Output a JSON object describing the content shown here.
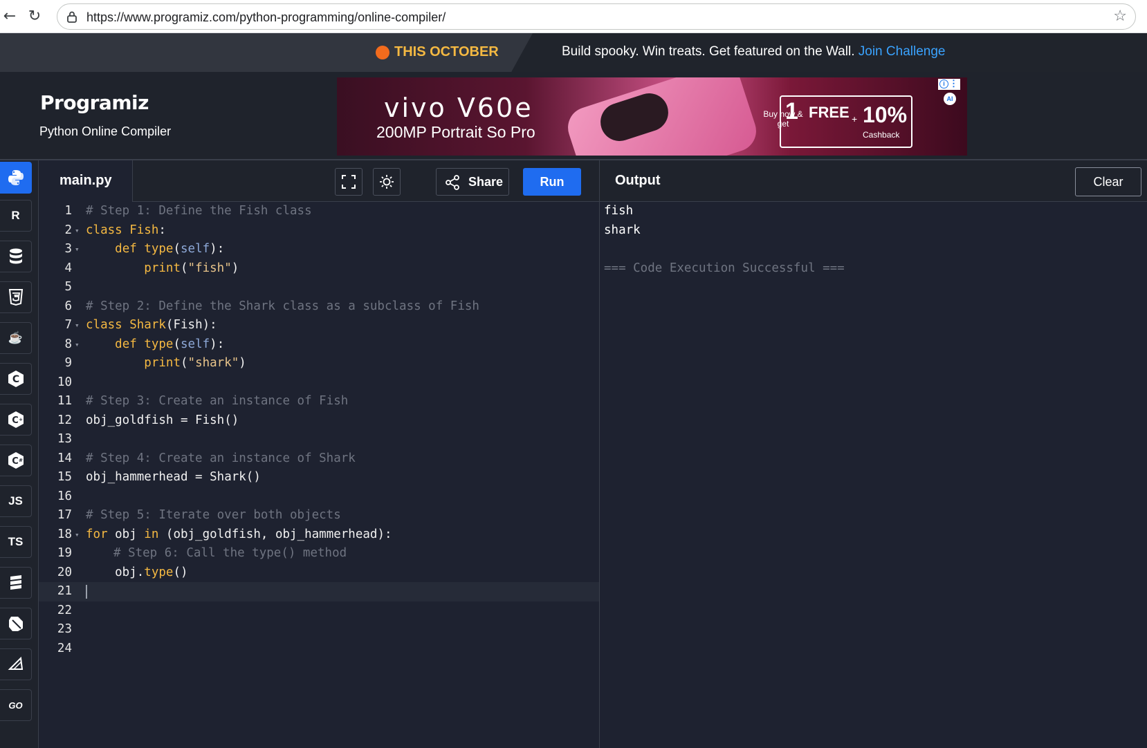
{
  "browser": {
    "url": "https://www.programiz.com/python-programming/online-compiler/"
  },
  "promo": {
    "tag": "THIS OCTOBER",
    "message": "Build spooky. Win treats. Get featured on the Wall.",
    "link": "Join Challenge"
  },
  "header": {
    "logo": "Programiz",
    "subtitle": "Python Online Compiler"
  },
  "ad": {
    "brand": "vivo V60e",
    "tagline": "200MP Portrait So Pro",
    "buy_now": "Buy now & get",
    "free_num": "1",
    "free": "FREE",
    "percent": "10%",
    "cashback": "Cashback",
    "ai": "AI"
  },
  "sidebar": {
    "items": [
      {
        "label": "Py",
        "name": "python"
      },
      {
        "label": "R",
        "name": "r"
      },
      {
        "label": "≡",
        "name": "sql"
      },
      {
        "label": "5",
        "name": "html"
      },
      {
        "label": "☕",
        "name": "java"
      },
      {
        "label": "C",
        "name": "c"
      },
      {
        "label": "C+",
        "name": "cpp"
      },
      {
        "label": "C#",
        "name": "csharp"
      },
      {
        "label": "JS",
        "name": "javascript"
      },
      {
        "label": "TS",
        "name": "typescript"
      },
      {
        "label": "≣",
        "name": "swift"
      },
      {
        "label": "◆",
        "name": "dart"
      },
      {
        "label": "◇",
        "name": "rust"
      },
      {
        "label": "GO",
        "name": "go"
      }
    ]
  },
  "editor": {
    "file_name": "main.py",
    "share_label": "Share",
    "run_label": "Run",
    "line_numbers": [
      "1",
      "2",
      "3",
      "4",
      "5",
      "6",
      "7",
      "8",
      "9",
      "10",
      "11",
      "12",
      "13",
      "14",
      "15",
      "16",
      "17",
      "18",
      "19",
      "20",
      "21",
      "22",
      "23",
      "24"
    ],
    "comments": {
      "c1": "# Step 1: Define the Fish class",
      "c2": "# Step 2: Define the Shark class as a subclass of Fish",
      "c3": "# Step 3: Create an instance of Fish",
      "c4": "# Step 4: Create an instance of Shark",
      "c5": "# Step 5: Iterate over both objects",
      "c6": "# Step 6: Call the type() method"
    }
  },
  "output": {
    "title": "Output",
    "clear_label": "Clear",
    "lines": [
      "fish",
      "shark",
      "",
      "=== Code Execution Successful ==="
    ]
  },
  "colors": {
    "accent": "#1f6cf0",
    "background": "#1e2230",
    "keyword": "#f5b942",
    "comment": "#6f7481"
  }
}
